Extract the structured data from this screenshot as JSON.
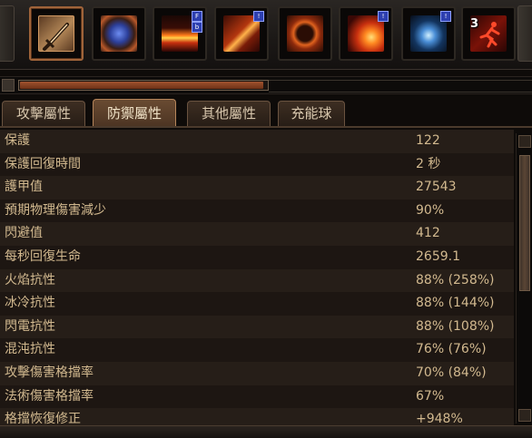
{
  "skills": [
    {
      "icon": "sword-icon",
      "selected": true
    },
    {
      "icon": "shield-orb-icon"
    },
    {
      "icon": "fire-wall-icon",
      "tags": [
        "F",
        "b"
      ]
    },
    {
      "icon": "fire-streak-icon",
      "tags": [
        "!"
      ]
    },
    {
      "icon": "fire-ring-icon"
    },
    {
      "icon": "fireball-icon",
      "tags": [
        "!"
      ]
    },
    {
      "icon": "ice-burst-icon",
      "tags": [
        "!"
      ]
    },
    {
      "icon": "running-man-icon",
      "count": "3"
    }
  ],
  "progress": 0.985,
  "tabs": [
    {
      "label": "攻擊屬性"
    },
    {
      "label": "防禦屬性",
      "active": true
    },
    {
      "label": "其他屬性"
    },
    {
      "label": "充能球"
    }
  ],
  "stats": [
    {
      "label": "保護",
      "value": "122"
    },
    {
      "label": "保護回復時間",
      "value": "2 秒"
    },
    {
      "label": "護甲值",
      "value": "27543"
    },
    {
      "label": "預期物理傷害減少",
      "value": "90%"
    },
    {
      "label": "閃避值",
      "value": "412"
    },
    {
      "label": "每秒回復生命",
      "value": "2659.1"
    },
    {
      "label": "火焰抗性",
      "value": "88% (258%)"
    },
    {
      "label": "冰冷抗性",
      "value": "88% (144%)"
    },
    {
      "label": "閃電抗性",
      "value": "88% (108%)"
    },
    {
      "label": "混沌抗性",
      "value": "76% (76%)"
    },
    {
      "label": "攻擊傷害格擋率",
      "value": "70% (84%)"
    },
    {
      "label": "法術傷害格擋率",
      "value": "67%"
    },
    {
      "label": "格擋恢復修正",
      "value": "+948%"
    }
  ],
  "colors": {
    "label": "#d2b98f",
    "tab_active": "#6a4b32",
    "progress": "#a0532f"
  }
}
